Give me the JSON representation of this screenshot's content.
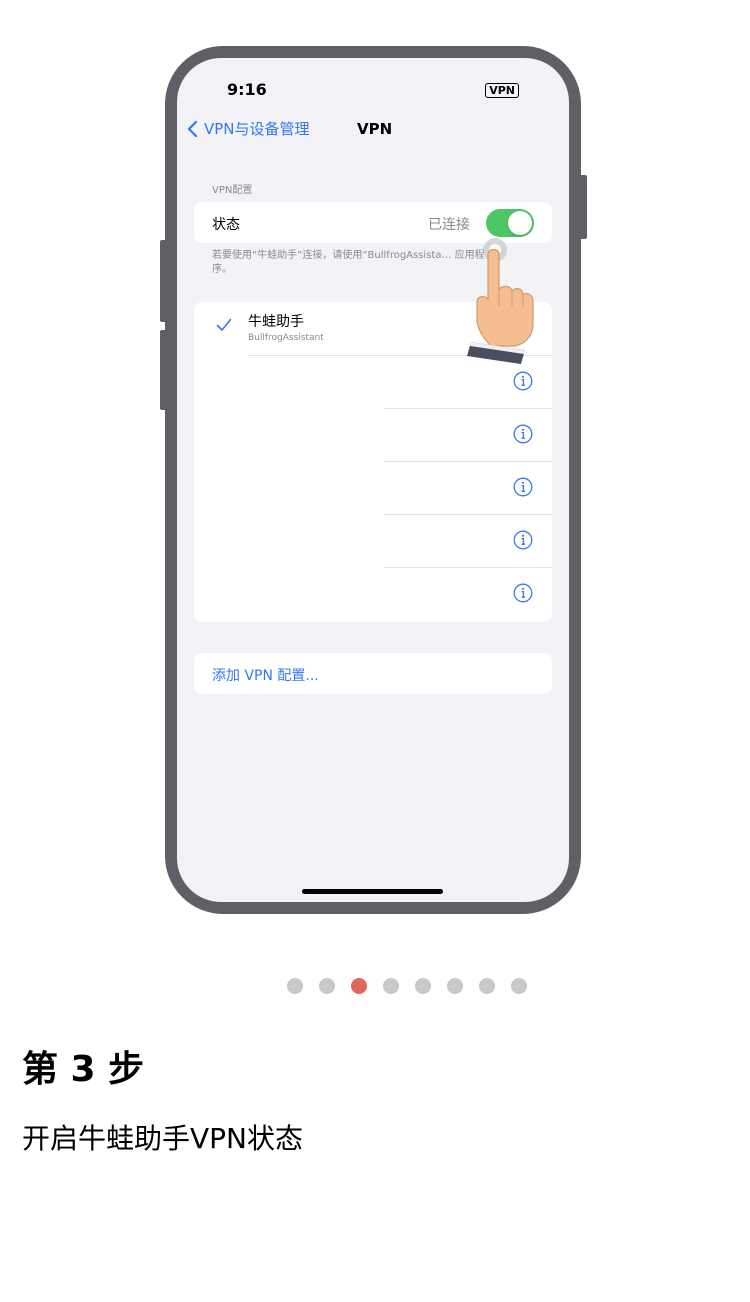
{
  "status_bar": {
    "time": "9:16",
    "vpn_badge": "VPN"
  },
  "nav": {
    "back_label": "VPN与设备管理",
    "title": "VPN"
  },
  "section_label": "VPN配置",
  "status_row": {
    "label": "状态",
    "value": "已连接",
    "toggle_on": true
  },
  "note": "若要使用“牛蛙助手”连接，请使用“BullfrogAssista… 应用程序。",
  "vpn_list": [
    {
      "name": "牛蛙助手",
      "subtitle": "BullfrogAssistant",
      "selected": true
    },
    {
      "name": "",
      "subtitle": "",
      "selected": false
    },
    {
      "name": "",
      "subtitle": "",
      "selected": false
    },
    {
      "name": "",
      "subtitle": "",
      "selected": false
    },
    {
      "name": "",
      "subtitle": "",
      "selected": false
    },
    {
      "name": "",
      "subtitle": "",
      "selected": false
    }
  ],
  "add_vpn_label": "添加 VPN 配置...",
  "pagination": {
    "total": 8,
    "active": 3
  },
  "step": {
    "title": "第 3 步",
    "description": "开启牛蛙助手VPN状态"
  },
  "colors": {
    "accent": "#3478f6",
    "toggle_on": "#4cc764",
    "dot_active": "#e0675a",
    "dot_inactive": "#c8c8c8"
  },
  "icons": {
    "back": "chevron-left-icon",
    "check": "checkmark-icon",
    "info": "info-circle-icon",
    "hand": "pointing-hand-icon"
  }
}
